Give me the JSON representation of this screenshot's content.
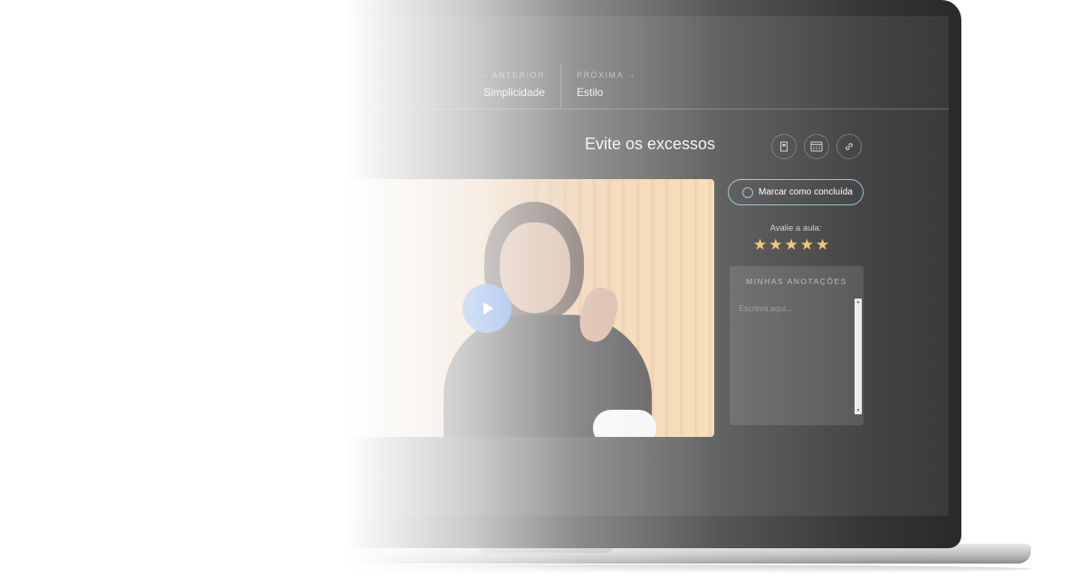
{
  "navigation": {
    "previous": {
      "kicker": "Anterior",
      "title": "Simplicidade",
      "arrow": "←"
    },
    "next": {
      "kicker": "Próxima",
      "title": "Estilo",
      "arrow": "→"
    }
  },
  "lesson": {
    "title": "Evite os excessos"
  },
  "actions": {
    "mark_complete_label": "Marcar como concluída"
  },
  "rating": {
    "label": "Avalie a aula:",
    "value": 5,
    "max": 5,
    "star_color": "#f3c25b"
  },
  "notes": {
    "title": "MINHAS ANOTAÇÕES",
    "placeholder": "Escreva aqui..."
  },
  "icons": {
    "bookmark": "bookmark-icon",
    "calendar": "calendar-icon",
    "link": "link-icon",
    "play": "play-icon"
  },
  "colors": {
    "accent_border": "#7dc3cc",
    "play_button": "#3d7bd6"
  }
}
